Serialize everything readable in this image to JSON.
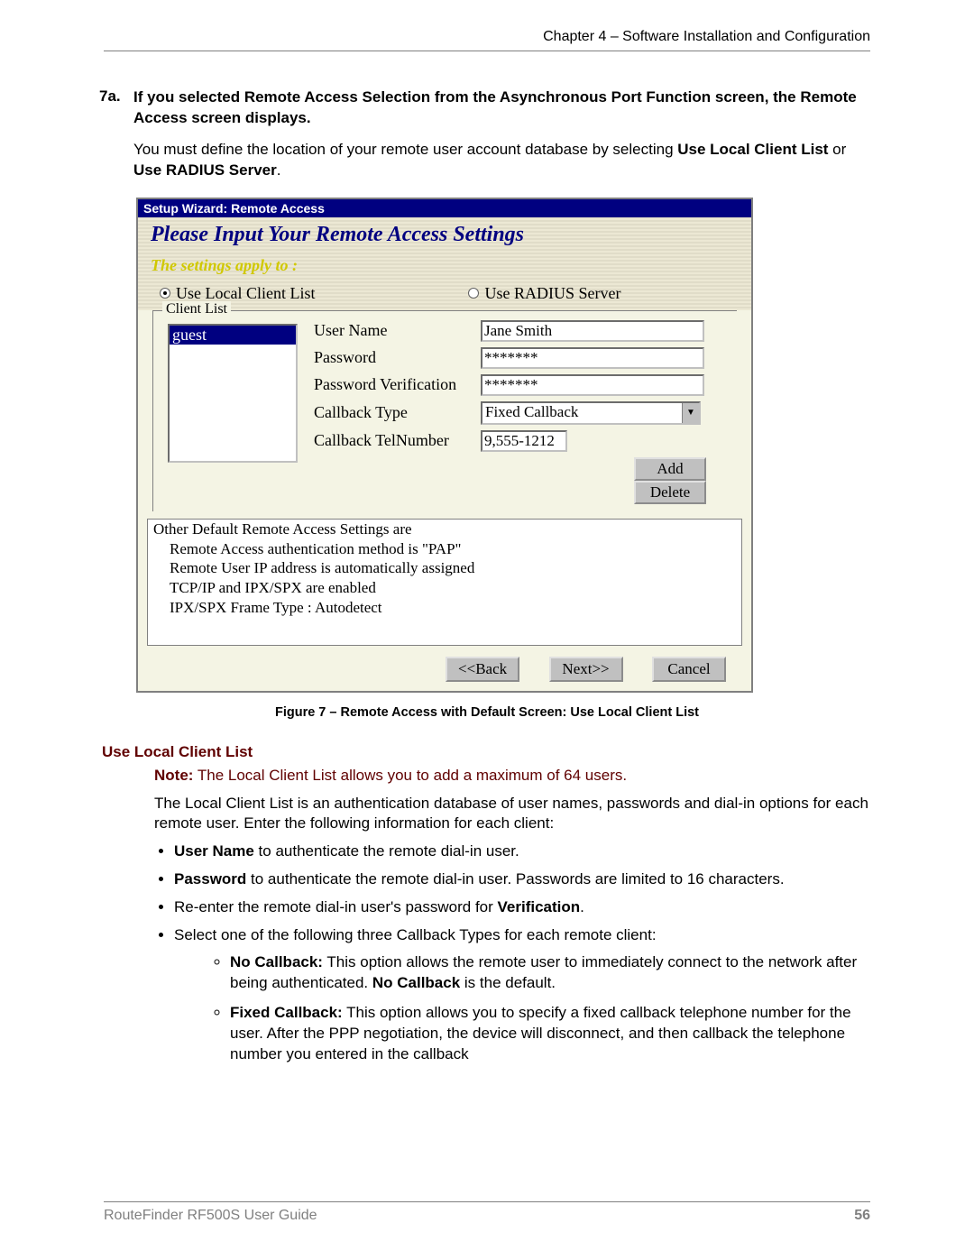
{
  "header": {
    "chapter": "Chapter 4 – Software Installation and Configuration"
  },
  "step": {
    "number": "7a.",
    "title": "If you selected Remote Access Selection from the Asynchronous Port Function screen, the Remote Access screen displays.",
    "intro_pre": "You must define the location of your remote user account database by selecting ",
    "intro_b1": "Use Local Client List",
    "intro_mid": " or ",
    "intro_b2": "Use RADIUS Server",
    "intro_post": "."
  },
  "wizard": {
    "titlebar": "Setup Wizard: Remote Access",
    "headline": "Please Input Your Remote Access Settings",
    "apply_to": "The settings apply to :",
    "radio_local": "Use Local Client List",
    "radio_radius": "Use RADIUS Server",
    "client_list_legend": "Client List",
    "list_items": [
      "guest"
    ],
    "labels": {
      "username": "User Name",
      "password": "Password",
      "passverify": "Password Verification",
      "cbtype": "Callback Type",
      "cbtel": "Callback TelNumber"
    },
    "values": {
      "username": "Jane Smith",
      "password": "*******",
      "passverify": "*******",
      "cbtype": "Fixed Callback",
      "cbtel": "9,555-1212"
    },
    "buttons": {
      "add": "Add",
      "delete": "Delete"
    },
    "info": {
      "l1": "Other Default Remote Access Settings are",
      "l2": "Remote Access authentication method is \"PAP\"",
      "l3": "Remote User IP address is automatically assigned",
      "l4": "TCP/IP and IPX/SPX are enabled",
      "l5": "IPX/SPX Frame Type : Autodetect"
    },
    "nav": {
      "back": "<<Back",
      "next": "Next>>",
      "cancel": "Cancel"
    }
  },
  "caption": "Figure 7 – Remote Access with Default Screen: Use Local Client List",
  "section": {
    "heading": "Use Local Client List",
    "note_label": "Note:",
    "note_body": " The Local Client List allows you to add a maximum of 64 users.",
    "desc": "The Local Client List is an authentication database of user names, passwords and dial-in options for each remote user. Enter the following information for each client:",
    "b_username": "User Name",
    "t_username": " to authenticate the remote dial-in user.",
    "b_password": "Password",
    "t_password": " to authenticate the remote dial-in user. Passwords are limited to 16 characters.",
    "t_verify_pre": "Re-enter the remote dial-in user's password for ",
    "b_verify": "Verification",
    "t_verify_post": ".",
    "t_callback_intro": "Select one of the following three Callback Types for each remote client:",
    "b_nocb": "No Callback:",
    "t_nocb_a": " This option allows the remote user to immediately connect to the network after being authenticated. ",
    "b_nocb2": "No Callback",
    "t_nocb_b": " is the default.",
    "b_fixed": "Fixed Callback:",
    "t_fixed": " This option allows you to specify a fixed callback telephone number for the user. After the PPP negotiation, the device will disconnect, and then callback the telephone number you entered in the callback"
  },
  "footer": {
    "left": "RouteFinder RF500S User Guide",
    "page": "56"
  }
}
